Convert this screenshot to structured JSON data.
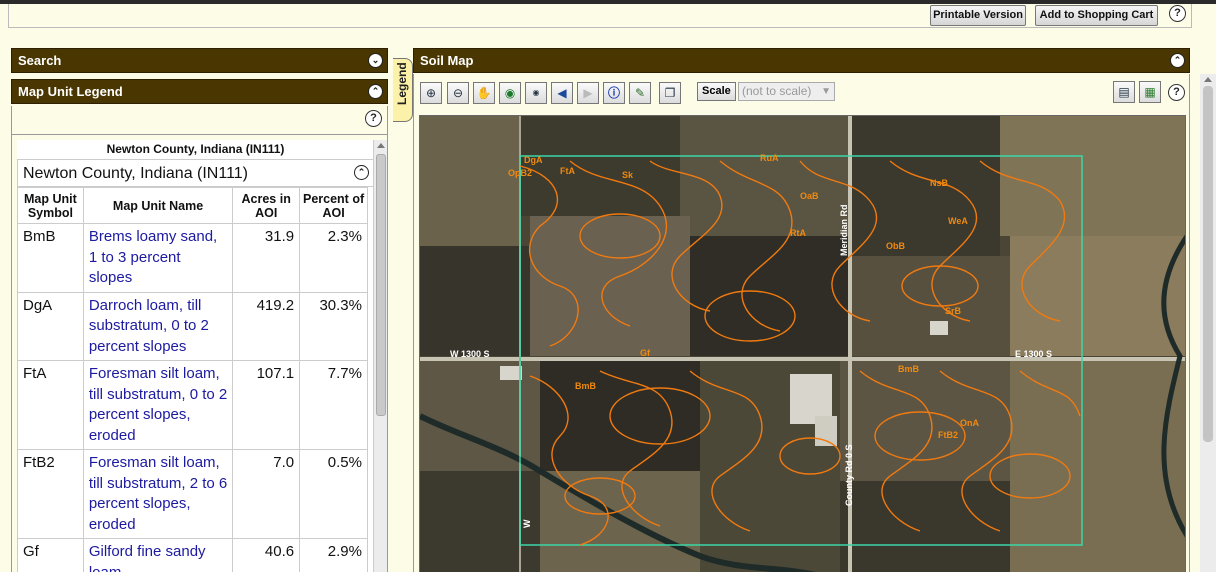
{
  "header": {
    "printable_label": "Printable Version",
    "cart_label": "Add to Shopping Cart",
    "help": "?"
  },
  "search_panel": {
    "title": "Search"
  },
  "legend_panel": {
    "title": "Map Unit Legend",
    "help": "?",
    "aoi_title": "Newton County, Indiana (IN111)",
    "aoi_header": "Newton County, Indiana (IN111)",
    "columns": [
      "Map Unit Symbol",
      "Map Unit Name",
      "Acres in AOI",
      "Percent of AOI"
    ],
    "rows": [
      {
        "symbol": "BmB",
        "name": "Brems loamy sand, 1 to 3 percent slopes",
        "acres": "31.9",
        "percent": "2.3%"
      },
      {
        "symbol": "DgA",
        "name": "Darroch loam, till substratum, 0 to 2 percent slopes",
        "acres": "419.2",
        "percent": "30.3%"
      },
      {
        "symbol": "FtA",
        "name": "Foresman silt loam, till substratum, 0 to 2 percent slopes, eroded",
        "acres": "107.1",
        "percent": "7.7%"
      },
      {
        "symbol": "FtB2",
        "name": "Foresman silt loam, till substratum, 2 to 6 percent slopes, eroded",
        "acres": "7.0",
        "percent": "0.5%"
      },
      {
        "symbol": "Gf",
        "name": "Gilford fine sandy loam",
        "acres": "40.6",
        "percent": "2.9%"
      }
    ]
  },
  "legend_tab": {
    "label": "Legend"
  },
  "soil_map": {
    "title": "Soil Map",
    "scale_label": "Scale",
    "scale_value": "(not to scale)",
    "help": "?",
    "road_labels": [
      "W 1300 S",
      "E 1300 S",
      "Meridian Rd",
      "County Rd 0 S",
      "W"
    ],
    "unit_labels": [
      "DgA",
      "OpB2",
      "FtA",
      "RuA",
      "Sk",
      "OaB",
      "RtA",
      "Gf",
      "NsB",
      "ObB",
      "WeA",
      "BmB",
      "SrB",
      "OnA",
      "FtB2",
      "BmB"
    ]
  },
  "colors": {
    "panel_bar": "#4a3600",
    "link": "#1c1aa0",
    "soil_line": "#f07a10",
    "aoi_outline": "#3cd6a8"
  }
}
